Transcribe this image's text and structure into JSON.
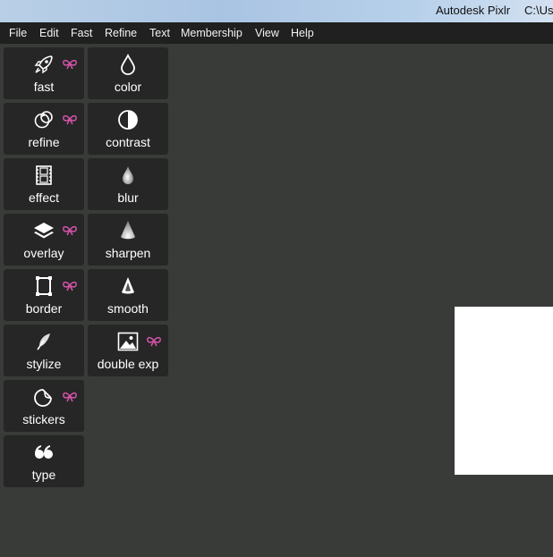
{
  "window": {
    "app_title": "Autodesk Pixlr",
    "path": "C:\\Us"
  },
  "menu": [
    "File",
    "Edit",
    "Fast",
    "Refine",
    "Text",
    "Membership",
    "View",
    "Help"
  ],
  "tools_left": [
    {
      "label": "fast",
      "icon": "rocket-icon",
      "premium": true
    },
    {
      "label": "refine",
      "icon": "refine-circles-icon",
      "premium": true
    },
    {
      "label": "effect",
      "icon": "film-strip-icon",
      "premium": false
    },
    {
      "label": "overlay",
      "icon": "layers-icon",
      "premium": true
    },
    {
      "label": "border",
      "icon": "frame-icon",
      "premium": true
    },
    {
      "label": "stylize",
      "icon": "feather-icon",
      "premium": false
    },
    {
      "label": "stickers",
      "icon": "sticker-icon",
      "premium": true
    },
    {
      "label": "type",
      "icon": "quote-icon",
      "premium": false
    }
  ],
  "tools_right": [
    {
      "label": "color",
      "icon": "drop-outline-icon",
      "premium": false
    },
    {
      "label": "contrast",
      "icon": "contrast-icon",
      "premium": false
    },
    {
      "label": "blur",
      "icon": "blur-drop-icon",
      "premium": false
    },
    {
      "label": "sharpen",
      "icon": "sharpen-cone-icon",
      "premium": false
    },
    {
      "label": "smooth",
      "icon": "smooth-cone-icon",
      "premium": false
    },
    {
      "label": "double exp",
      "icon": "image-icon",
      "premium": true
    }
  ],
  "colors": {
    "background": "#383b38",
    "menubar": "#1f201f",
    "tool_tile": "#252625",
    "premium_bow": "#d453a8"
  }
}
